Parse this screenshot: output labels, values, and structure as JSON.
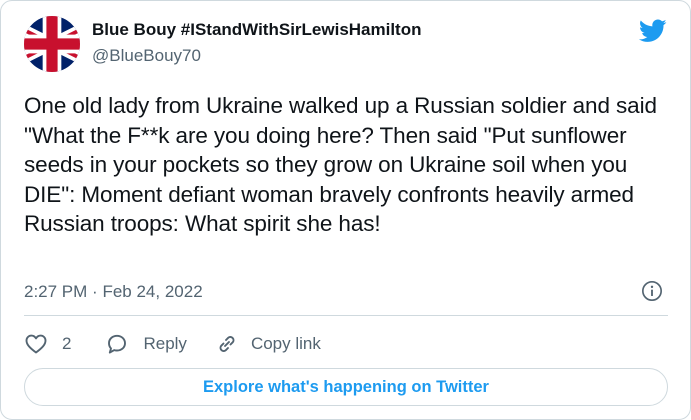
{
  "tweet": {
    "author_name": "Blue Bouy #IStandWithSirLewisHamilton",
    "author_handle": "@BlueBouy70",
    "avatar_icon": "union-jack-flag",
    "text": "One old lady from Ukraine walked up a Russian soldier and said \"What the F**k are you doing here? Then said \"Put sunflower seeds in your pockets so they grow on Ukraine soil when you DIE\": Moment defiant woman bravely confronts heavily armed Russian troops: What spirit she has!",
    "time": "2:27 PM",
    "separator": "·",
    "date": "Feb 24, 2022"
  },
  "actions": {
    "like_count": "2",
    "reply_label": "Reply",
    "copy_label": "Copy link"
  },
  "explore": {
    "label": "Explore what's happening on Twitter"
  },
  "colors": {
    "brand": "#1d9bf0",
    "text": "#0f1419",
    "secondary": "#536471",
    "border": "#cfd9de"
  }
}
